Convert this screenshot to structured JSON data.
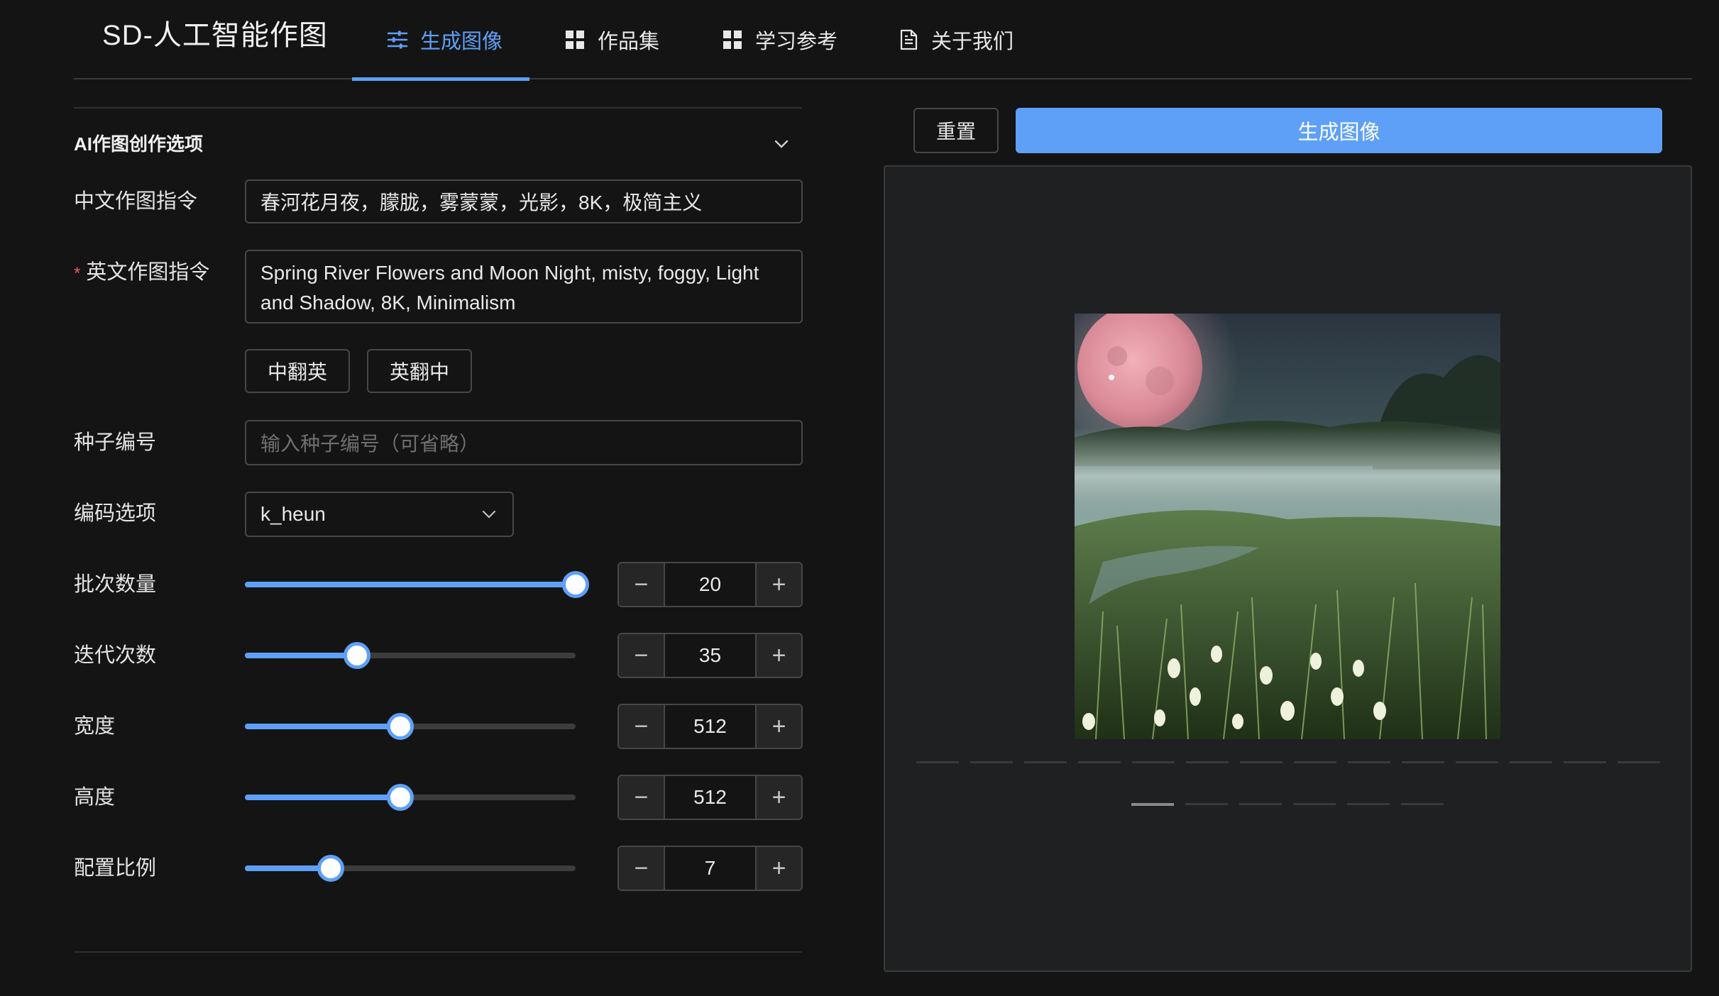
{
  "app": {
    "title": "SD-人工智能作图"
  },
  "nav": {
    "items": [
      {
        "label": "生成图像",
        "icon": "sliders-icon",
        "active": true
      },
      {
        "label": "作品集",
        "icon": "grid-icon",
        "active": false
      },
      {
        "label": "学习参考",
        "icon": "grid-icon",
        "active": false
      },
      {
        "label": "关于我们",
        "icon": "document-icon",
        "active": false
      }
    ]
  },
  "form": {
    "section_title": "AI作图创作选项",
    "cn_prompt": {
      "label": "中文作图指令",
      "value": "春河花月夜，朦胧，雾蒙蒙，光影，8K，极简主义"
    },
    "en_prompt": {
      "required_mark": "*",
      "label": "英文作图指令",
      "value": "Spring River Flowers and Moon Night, misty, foggy, Light and Shadow,  8K, Minimalism"
    },
    "translate_cn_en": "中翻英",
    "translate_en_cn": "英翻中",
    "seed": {
      "label": "种子编号",
      "placeholder": "输入种子编号（可省略）",
      "value": ""
    },
    "sampler": {
      "label": "编码选项",
      "value": "k_heun"
    },
    "batch": {
      "label": "批次数量",
      "value": "20",
      "fraction": 1.0
    },
    "steps": {
      "label": "迭代次数",
      "value": "35",
      "fraction": 0.34
    },
    "width": {
      "label": "宽度",
      "value": "512",
      "fraction": 0.47
    },
    "height": {
      "label": "高度",
      "value": "512",
      "fraction": 0.47
    },
    "cfg_scale": {
      "label": "配置比例",
      "value": "7",
      "fraction": 0.26
    },
    "stepper_minus": "−",
    "stepper_plus": "+"
  },
  "actions": {
    "reset": "重置",
    "generate": "生成图像"
  },
  "colors": {
    "accent": "#5ea0f8",
    "background": "#141414",
    "required": "#e35b5b"
  }
}
